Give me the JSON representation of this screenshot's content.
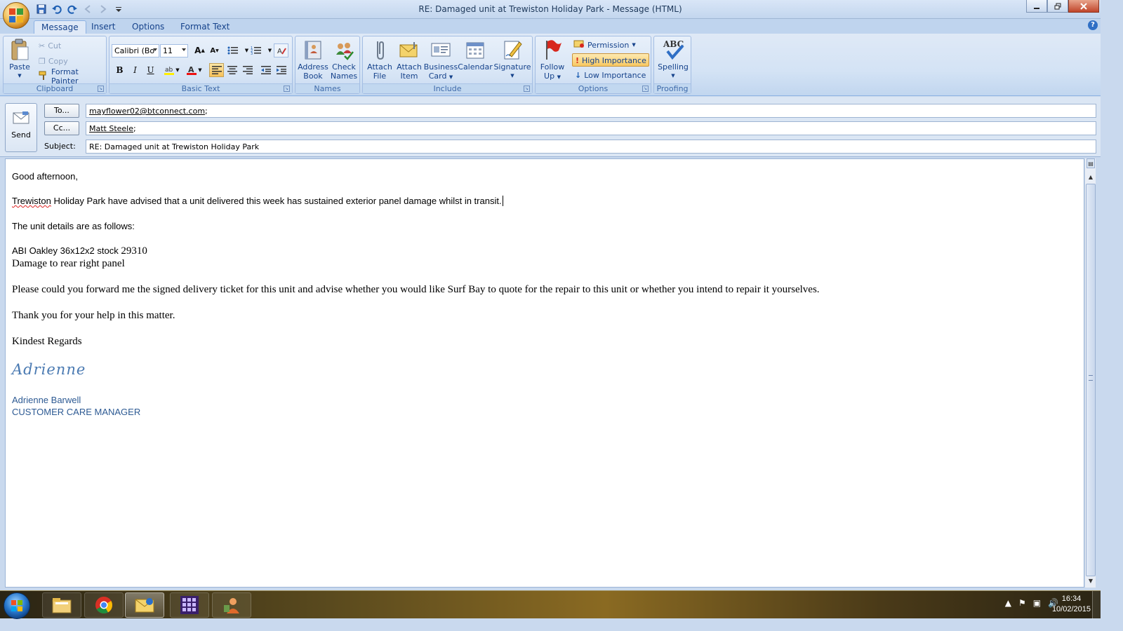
{
  "window": {
    "title": "RE: Damaged unit at Trewiston Holiday Park - Message (HTML)"
  },
  "tabs": [
    "Message",
    "Insert",
    "Options",
    "Format Text"
  ],
  "ribbon": {
    "clipboard": {
      "label": "Clipboard",
      "paste": "Paste",
      "cut": "Cut",
      "copy": "Copy",
      "format_painter": "Format Painter"
    },
    "basic_text": {
      "label": "Basic Text",
      "font": "Calibri (Bo",
      "size": "11"
    },
    "names": {
      "label": "Names",
      "address_book": [
        "Address",
        "Book"
      ],
      "check_names": [
        "Check",
        "Names"
      ]
    },
    "include": {
      "label": "Include",
      "attach_file": [
        "Attach",
        "File"
      ],
      "attach_item": [
        "Attach",
        "Item"
      ],
      "business_card": [
        "Business",
        "Card"
      ],
      "calendar": "Calendar",
      "signature": "Signature"
    },
    "options": {
      "label": "Options",
      "follow_up": [
        "Follow",
        "Up"
      ],
      "permission": "Permission",
      "high_importance": "High Importance",
      "low_importance": "Low Importance"
    },
    "proofing": {
      "label": "Proofing",
      "spelling": "Spelling",
      "abc": "ABC"
    }
  },
  "header": {
    "send": "Send",
    "to_button": "To...",
    "cc_button": "Cc...",
    "subject_label": "Subject:",
    "to_value": "mayflower02@btconnect.com",
    "cc_value": "Matt Steele",
    "subject_value": "RE: Damaged unit at Trewiston Holiday Park"
  },
  "body": {
    "greeting": "Good afternoon,",
    "para1_word": "Trewiston",
    "para1_rest": " Holiday Park have advised that  a unit delivered this week has sustained exterior panel damage whilst in transit.",
    "para2": "The unit details are as follows:",
    "detail1": "ABI Oakley 36x12x2 stock ",
    "detail1_num": "29310",
    "detail2": "Damage to rear right panel",
    "para3": "Please could you forward me the signed delivery ticket for this unit and advise whether you would like Surf Bay to quote for the repair to this unit or whether you intend to repair it yourselves.",
    "para4": "Thank you for your help in this matter.",
    "closing": "Kindest Regards",
    "signature_script": "Adrienne",
    "sig_name": "Adrienne Barwell",
    "sig_title": "CUSTOMER CARE MANAGER"
  },
  "taskbar": {
    "time": "16:34",
    "date": "10/02/2015"
  },
  "colors": {
    "ribbon_text": "#15428b",
    "high_importance_bg": "#f8c862",
    "signature_blue": "#2d5a93"
  }
}
